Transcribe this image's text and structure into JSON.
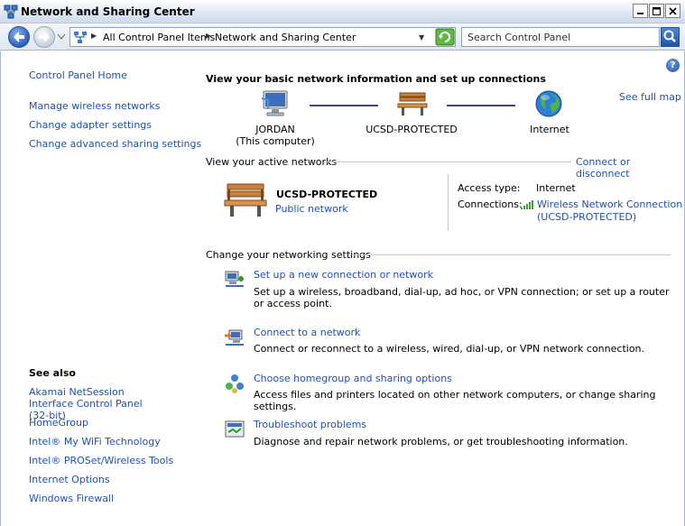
{
  "window": {
    "title": "Network and Sharing Center"
  },
  "address": {
    "crumbs": [
      "All Control Panel Items",
      "Network and Sharing Center"
    ],
    "search_placeholder": "Search Control Panel"
  },
  "left_pane": {
    "home": "Control Panel Home",
    "links": [
      "Manage wireless networks",
      "Change adapter settings",
      "Change advanced sharing settings"
    ],
    "see_also_title": "See also",
    "see_also": [
      "Akamai NetSession Interface Control Panel (32-bit)",
      "HomeGroup",
      "Intel® My WiFi Technology",
      "Intel® PROSet/Wireless Tools",
      "Internet Options",
      "Windows Firewall"
    ]
  },
  "main": {
    "heading": "View your basic network information and set up connections",
    "see_full_map": "See full map",
    "map": {
      "computer_name": "JORDAN",
      "computer_sub": "(This computer)",
      "network_name": "UCSD-PROTECTED",
      "internet": "Internet"
    },
    "active_title": "View your active networks",
    "connect_disconnect": "Connect or disconnect",
    "active_network": {
      "name": "UCSD-PROTECTED",
      "type": "Public network",
      "access_label": "Access type:",
      "access_value": "Internet",
      "connections_label": "Connections:",
      "connection_line1": "Wireless Network Connection",
      "connection_line2": "(UCSD-PROTECTED)"
    },
    "change_title": "Change your networking settings",
    "tasks": [
      {
        "link": "Set up a new connection or network",
        "desc": "Set up a wireless, broadband, dial-up, ad hoc, or VPN connection; or set up a router or access point."
      },
      {
        "link": "Connect to a network",
        "desc": "Connect or reconnect to a wireless, wired, dial-up, or VPN network connection."
      },
      {
        "link": "Choose homegroup and sharing options",
        "desc": "Access files and printers located on other network computers, or change sharing settings."
      },
      {
        "link": "Troubleshoot problems",
        "desc": "Diagnose and repair network problems, or get troubleshooting information."
      }
    ]
  }
}
